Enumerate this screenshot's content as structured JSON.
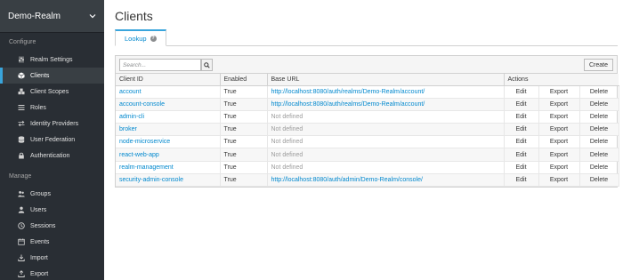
{
  "sidebar": {
    "realm": "Demo-Realm",
    "configure_label": "Configure",
    "manage_label": "Manage",
    "configure_items": [
      {
        "label": "Realm Settings",
        "icon": "sliders-icon"
      },
      {
        "label": "Clients",
        "icon": "cube-icon"
      },
      {
        "label": "Client Scopes",
        "icon": "cubes-icon"
      },
      {
        "label": "Roles",
        "icon": "list-icon"
      },
      {
        "label": "Identity Providers",
        "icon": "exchange-icon"
      },
      {
        "label": "User Federation",
        "icon": "database-icon"
      },
      {
        "label": "Authentication",
        "icon": "lock-icon"
      }
    ],
    "manage_items": [
      {
        "label": "Groups",
        "icon": "users-icon"
      },
      {
        "label": "Users",
        "icon": "user-icon"
      },
      {
        "label": "Sessions",
        "icon": "clock-icon"
      },
      {
        "label": "Events",
        "icon": "calendar-icon"
      },
      {
        "label": "Import",
        "icon": "import-icon"
      },
      {
        "label": "Export",
        "icon": "export-icon"
      }
    ],
    "active": "Clients"
  },
  "main": {
    "title": "Clients",
    "tab_label": "Lookup",
    "search_placeholder": "Search...",
    "create_label": "Create",
    "columns": [
      "Client ID",
      "Enabled",
      "Base URL",
      "Actions"
    ],
    "action_labels": [
      "Edit",
      "Export",
      "Delete"
    ],
    "rows": [
      {
        "id": "account",
        "enabled": "True",
        "url": "http://localhost:8080/auth/realms/Demo-Realm/account/",
        "defined": true
      },
      {
        "id": "account-console",
        "enabled": "True",
        "url": "http://localhost:8080/auth/realms/Demo-Realm/account/",
        "defined": true
      },
      {
        "id": "admin-cli",
        "enabled": "True",
        "url": "Not defined",
        "defined": false
      },
      {
        "id": "broker",
        "enabled": "True",
        "url": "Not defined",
        "defined": false
      },
      {
        "id": "node-microservice",
        "enabled": "True",
        "url": "Not defined",
        "defined": false
      },
      {
        "id": "react-web-app",
        "enabled": "True",
        "url": "Not defined",
        "defined": false
      },
      {
        "id": "realm-management",
        "enabled": "True",
        "url": "Not defined",
        "defined": false
      },
      {
        "id": "security-admin-console",
        "enabled": "True",
        "url": "http://localhost:8080/auth/admin/Demo-Realm/console/",
        "defined": true
      }
    ]
  },
  "colors": {
    "sidebar_bg": "#292e34",
    "active_accent": "#39a5dc",
    "link": "#0088ce"
  }
}
